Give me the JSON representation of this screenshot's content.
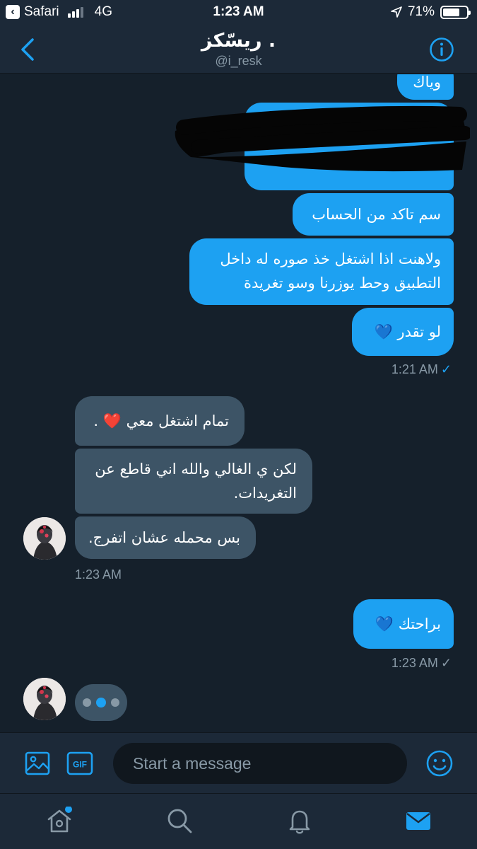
{
  "status_bar": {
    "back_app": "Safari",
    "network": "4G",
    "time": "1:23 AM",
    "battery": "71%",
    "battery_level": 0.71
  },
  "header": {
    "title": "ريسّكز .",
    "handle": "@i_resk"
  },
  "messages": {
    "out_partial": "وياك",
    "out_1": "سم تاكد من الحساب",
    "out_2": "ولاهنت اذا اشتغل خذ صوره له داخل التطبيق وحط يوزرنا وسو تغريدة",
    "out_3": "لو تقدر 💙",
    "ts_1": "1:21 AM",
    "in_1": "تمام اشتغل معي ❤️ .",
    "in_2": "لكن ي الغالي والله اني قاطع عن التغريدات.",
    "in_3": "بس محمله عشان اتفرج.",
    "ts_2": "1:23 AM",
    "out_4": "براحتك 💙",
    "ts_3": "1:23 AM"
  },
  "compose": {
    "placeholder": "Start a message",
    "gif_label": "GIF"
  },
  "colors": {
    "accent": "#1da1f2",
    "background": "#15202b",
    "bar": "#1c2938",
    "incoming_bubble": "#3d5466"
  },
  "icons": [
    "back-chevron-icon",
    "info-icon",
    "image-icon",
    "gif-icon",
    "emoji-icon",
    "home-icon",
    "search-icon",
    "notifications-icon",
    "messages-icon"
  ]
}
